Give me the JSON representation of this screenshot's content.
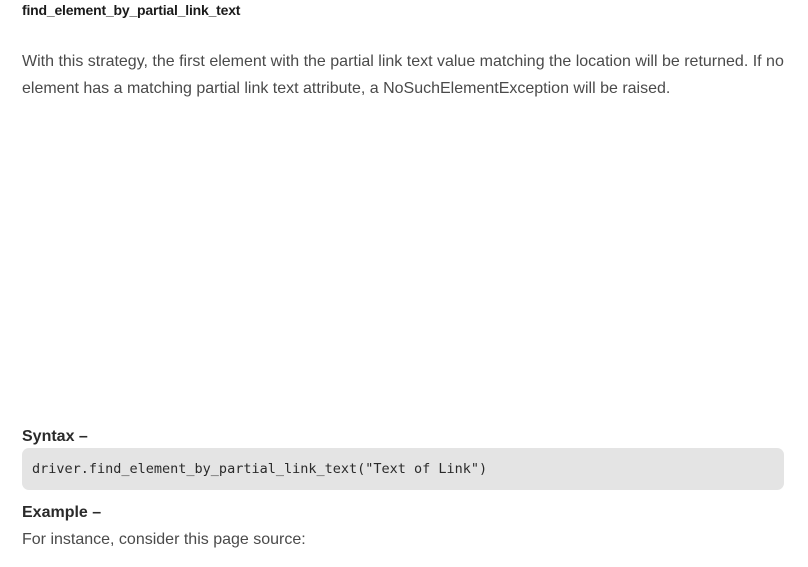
{
  "section": {
    "heading": "find_element_by_partial_link_text",
    "description": "With this strategy, the first element with the partial link text value matching the location will be returned. If no element has a matching partial link text attribute, a NoSuchElementException will be raised."
  },
  "syntax": {
    "label": "Syntax –",
    "code": "driver.find_element_by_partial_link_text(\"Text of Link\")"
  },
  "example": {
    "label": "Example –",
    "intro": "For instance, consider this page source:"
  }
}
